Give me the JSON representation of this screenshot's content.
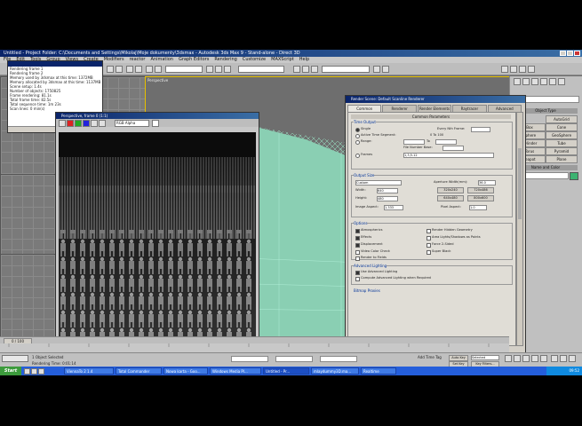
{
  "window": {
    "title": "Untitled  - Project Folder: C:\\Documents and Settings\\Mikolaj\\Moje dokumenty\\3dsmax  - Autodesk 3ds Max 9  - Stand-alone  - Direct 3D"
  },
  "menu": [
    "File",
    "Edit",
    "Tools",
    "Group",
    "Views",
    "Create",
    "Modifiers",
    "reactor",
    "Animation",
    "Graph Editors",
    "Rendering",
    "Customize",
    "MAXScript",
    "Help"
  ],
  "messages": {
    "lines": [
      "Rendering frame 1",
      "Rendering frame 2",
      "Memory used by 3dsmax at this time: 1372MB",
      "Memory allocated by 3dsmax at this time: 1137MB",
      "Scene setup: 1.4s",
      "Number of objects: 1750825",
      "Frame rendering: 81.1s",
      "Total frame time: 82.5s",
      "Total sequence time: 1m 23s",
      "Scan lines: 0 min(s)"
    ]
  },
  "viewports": {
    "perspective_label": "Perspective"
  },
  "vfb": {
    "title": "Perspective, frame 0 (1:1)",
    "channel": "RGB Alpha"
  },
  "render_dialog": {
    "title": "Render Scene: Default Scanline Renderer",
    "tabs": [
      "Common",
      "Renderer",
      "Render Elements",
      "Raytracer",
      "Advanced Lighting"
    ],
    "active_tab": "Common",
    "section_title": "Common Parameters",
    "time_output": {
      "label": "Time Output",
      "single": "Single",
      "every_nth": "Every Nth Frame:",
      "active_segment": "Active Time Segment:",
      "active_segment_value": "0 To 100",
      "range": "Range:",
      "range_to": "To",
      "file_number_base": "File Number Base:",
      "frames": "Frames",
      "frames_value": "1,3,5-12"
    },
    "output_size": {
      "label": "Output Size",
      "preset": "Custom",
      "aperture": "Aperture Width(mm):",
      "aperture_value": "36.0",
      "width": "Width:",
      "width_value": "640",
      "height": "Height:",
      "height_value": "480",
      "image_aspect": "Image Aspect:",
      "image_aspect_value": "1.333",
      "pixel_aspect": "Pixel Aspect:",
      "pixel_aspect_value": "1.0",
      "presets": [
        "320x240",
        "720x486",
        "640x480",
        "800x600"
      ]
    },
    "options": {
      "label": "Options",
      "atmospherics": "Atmospherics",
      "render_hidden": "Render Hidden Geometry",
      "effects": "Effects",
      "area_lights": "Area Lights/Shadows as Points",
      "displacement": "Displacement",
      "force_2sided": "Force 2-Sided",
      "video_color": "Video Color Check",
      "super_black": "Super Black",
      "render_fields": "Render to Fields"
    },
    "advanced_lighting": {
      "label": "Advanced Lighting",
      "use": "Use Advanced Lighting",
      "compute": "Compute Advanced Lighting when Required"
    },
    "bitmap_proxies": "Bitmap Proxies",
    "production": "Production",
    "activeshade": "ActiveShade",
    "preset_label": "Preset:",
    "viewport_label": "Viewport:",
    "viewport_value": "Perspective",
    "render_button": "Render"
  },
  "command_panel": {
    "object_type": "Object Type",
    "buttons": [
      "AutoGrid",
      "Box",
      "Cone",
      "Sphere",
      "GeoSphere",
      "Cylinder",
      "Tube",
      "Torus",
      "Pyramid",
      "Teapot",
      "Plane"
    ],
    "name_color": "Name and Color",
    "object_name": "Box01"
  },
  "bottom": {
    "time_slider": "0 / 100",
    "status": "1 Object Selected",
    "render_time": "Rendering Time: 0:01:14",
    "auto_key": "Auto Key",
    "selected": "Selected",
    "set_key": "Set Key",
    "key_filters": "Key Filters...",
    "add_time_tag": "Add Time Tag"
  },
  "taskbar": {
    "start": "Start",
    "tasks": [
      "ViennaTo 2 1.4",
      "Total Commander",
      "Nowa karta - Goo...",
      "Windows Media Pl...",
      "Untitled - Pr...",
      "mlaydummy3D.ma...",
      "Realtime"
    ],
    "clock": "09:52"
  },
  "colors": {
    "title_blue": "#0a246a",
    "viewport_gray": "#6e6e6e",
    "wire_green": "#8fe0c0",
    "active_viewport_border": "#e6c000"
  }
}
